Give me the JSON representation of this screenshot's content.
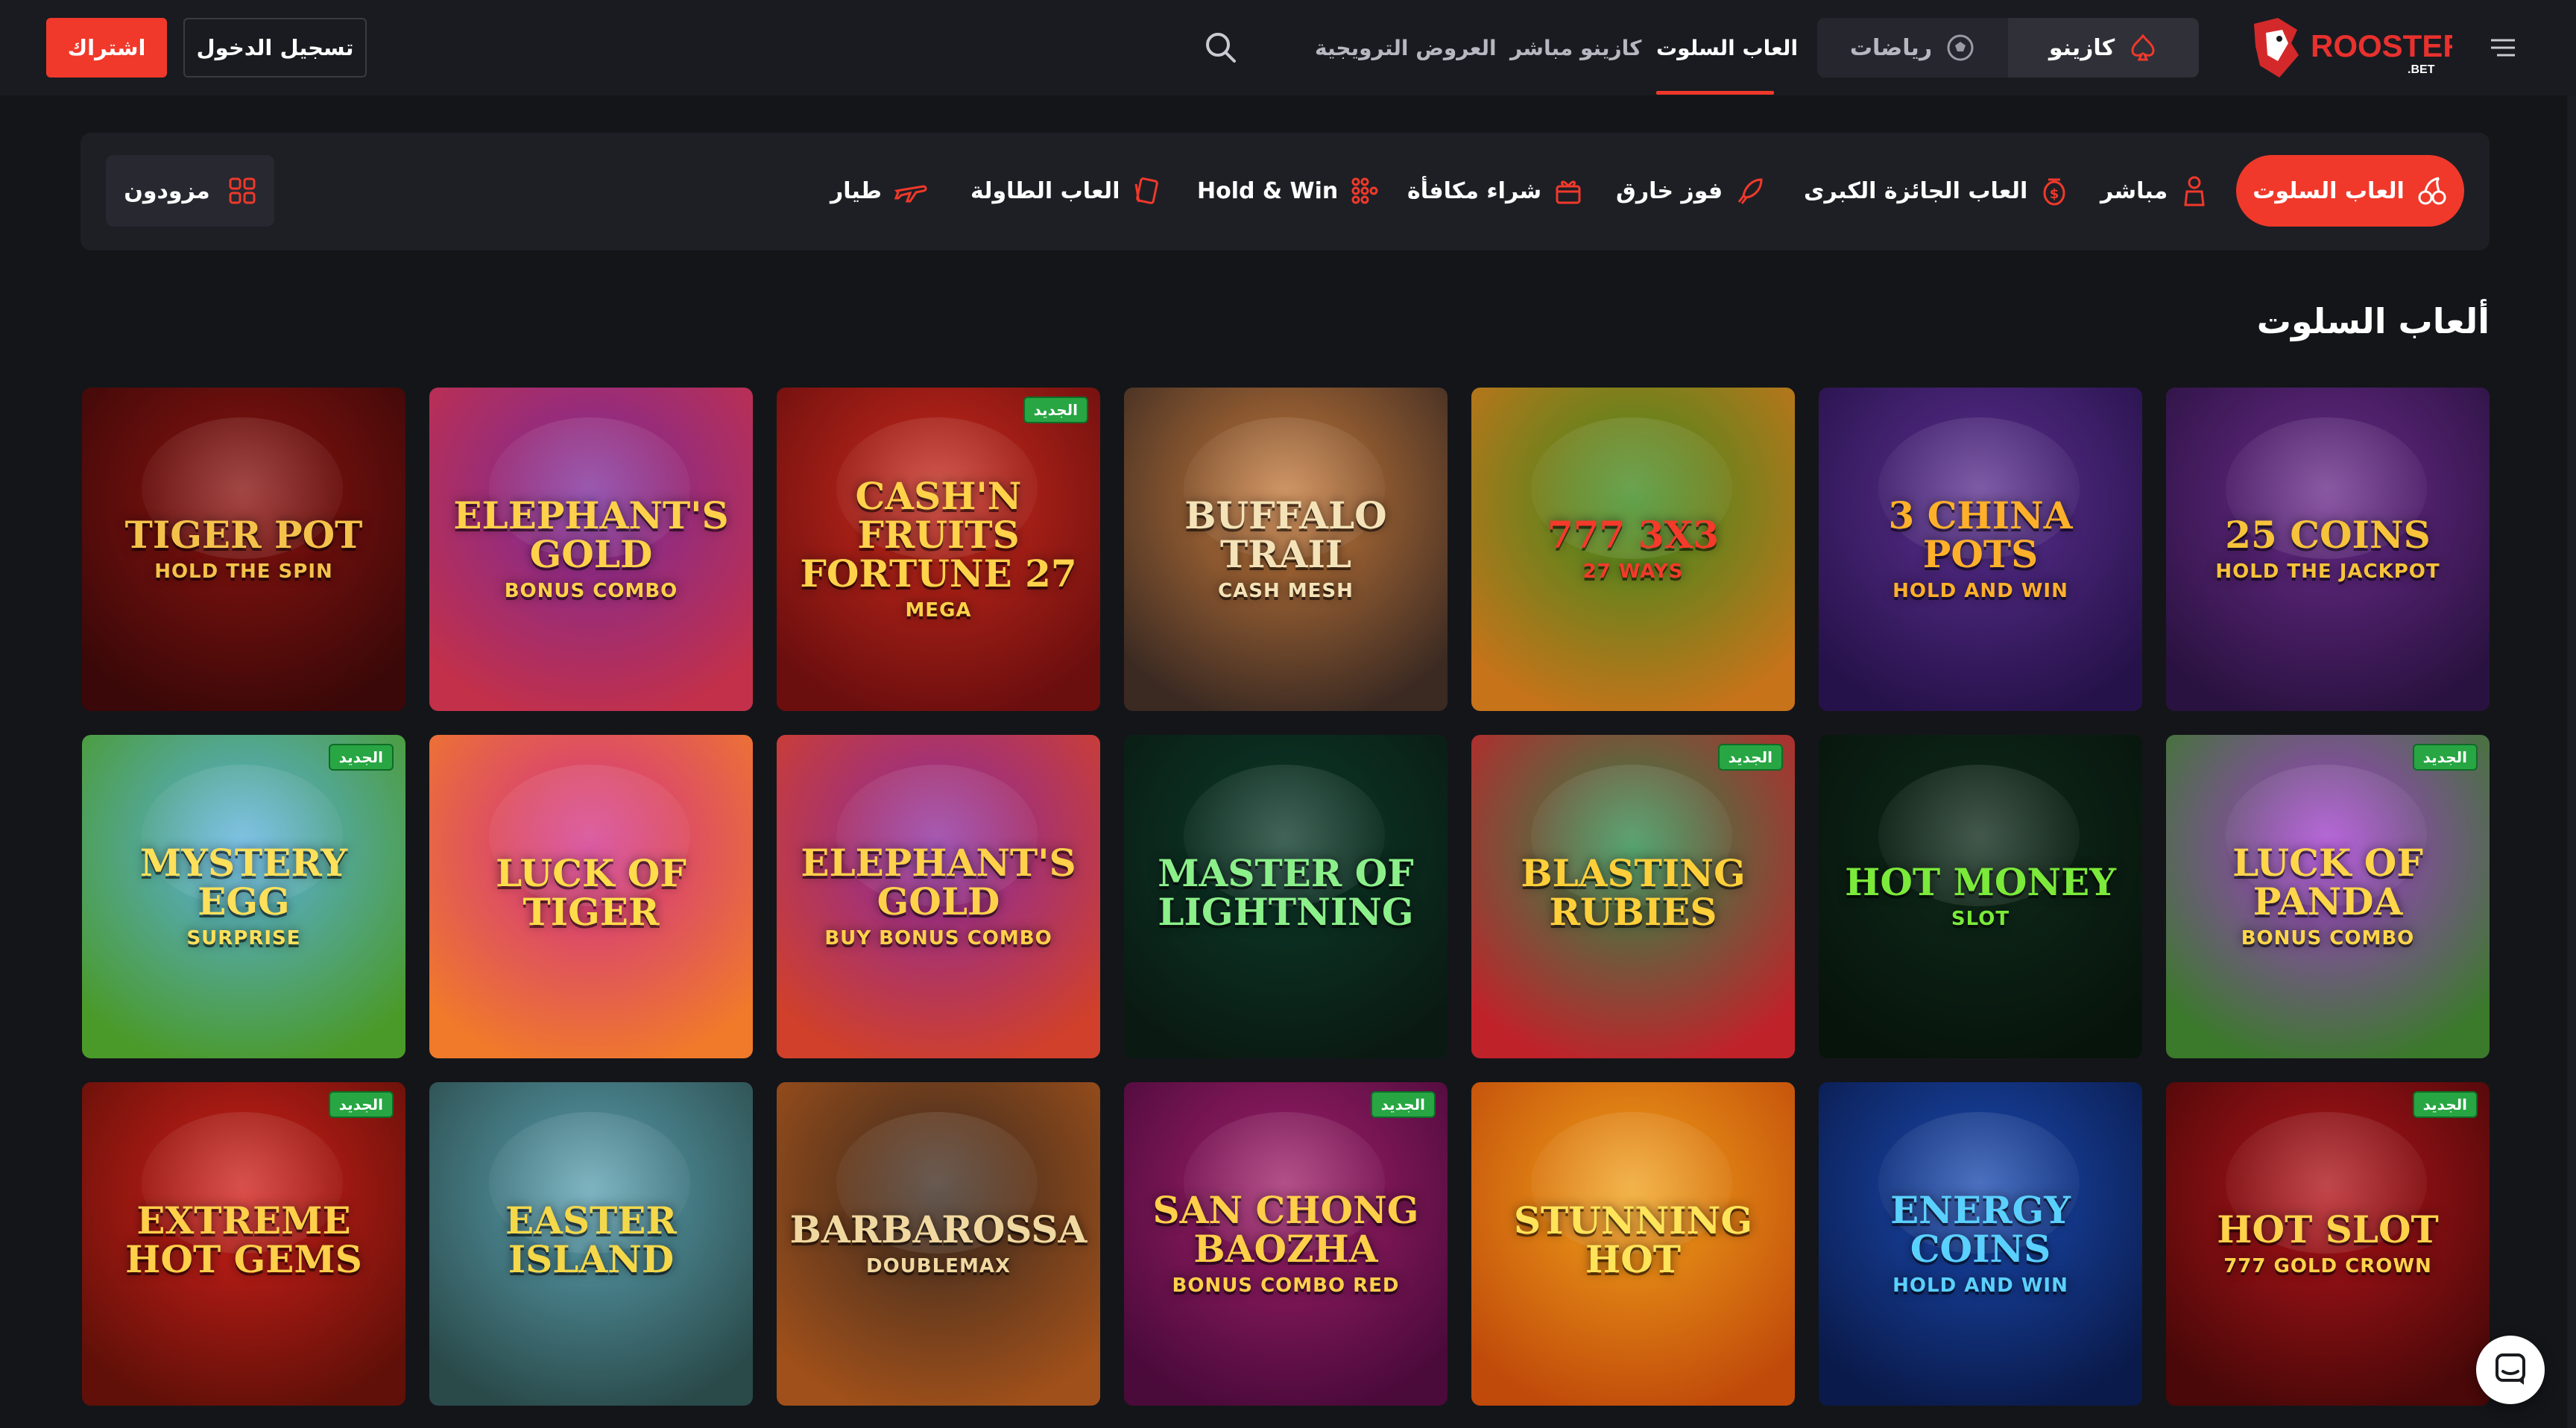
{
  "header": {
    "signup_label": "اشتراك",
    "login_label": "تسجيل الدخول",
    "nav": [
      {
        "label": "العروض الترويجية"
      },
      {
        "label": "كازينو مباشر"
      },
      {
        "label": "العاب السلوت"
      }
    ],
    "segments": [
      {
        "label": "رياضات",
        "icon": "soccer-ball-icon"
      },
      {
        "label": "كازينو",
        "icon": "spade-icon"
      }
    ],
    "logo_text": "ROOSTER",
    "logo_sub": ".BET"
  },
  "categories": {
    "providers_label": "مزودون",
    "items": [
      {
        "label": "العاب السلوت",
        "icon": "cherries-icon",
        "active": true
      },
      {
        "label": "مباشر",
        "icon": "dealer-icon"
      },
      {
        "label": "العاب الجائزة الكبرى",
        "icon": "coin-icon"
      },
      {
        "label": "فوز خارق",
        "icon": "rocket-icon"
      },
      {
        "label": "شراء مكافأة",
        "icon": "gift-icon"
      },
      {
        "label": "Hold & Win",
        "icon": "grid-dots-icon"
      },
      {
        "label": "العاب الطاولة",
        "icon": "cards-icon"
      },
      {
        "label": "طيار",
        "icon": "plane-icon"
      }
    ]
  },
  "section": {
    "title": "ألعاب السلوت"
  },
  "badge_label": "الجديد",
  "games": [
    {
      "title": "25 COINS",
      "sub": "HOLD THE JACKPOT",
      "new": false,
      "bg": "#6a2b8a",
      "bg2": "#2a1240",
      "fg": "#f6c33a"
    },
    {
      "title": "3 CHINA POTS",
      "sub": "HOLD AND WIN",
      "new": false,
      "bg": "#5b2f8f",
      "bg2": "#26124a",
      "fg": "#ffb02a"
    },
    {
      "title": "777 3X3",
      "sub": "27 WAYS",
      "new": false,
      "bg": "#3a8a1e",
      "bg2": "#c7731a",
      "fg": "#f43a2a"
    },
    {
      "title": "BUFFALO TRAIL",
      "sub": "CASH MESH",
      "new": false,
      "bg": "#c5793a",
      "bg2": "#3b2a22",
      "fg": "#f4e3b8"
    },
    {
      "title": "Cash'n Fruits Fortune 27",
      "sub": "MEGA",
      "new": true,
      "bg": "#c92a1c",
      "bg2": "#6a0e0e",
      "fg": "#ffd24a"
    },
    {
      "title": "ELEPHANT'S GOLD",
      "sub": "BONUS COMBO",
      "new": false,
      "bg": "#7a2a9b",
      "bg2": "#c2304a",
      "fg": "#ffd14a"
    },
    {
      "title": "TIGER POT",
      "sub": "HOLD THE SPIN",
      "new": false,
      "bg": "#8a1410",
      "bg2": "#3a0808",
      "fg": "#f4c24a"
    },
    {
      "title": "LUCK OF PANDA",
      "sub": "BONUS COMBO",
      "new": true,
      "bg": "#a33ad0",
      "bg2": "#3a7a2a",
      "fg": "#ffd64a"
    },
    {
      "title": "HOT MONEY",
      "sub": "Slot",
      "new": false,
      "bg": "#0f2a1a",
      "bg2": "#07140c",
      "fg": "#7bea3a"
    },
    {
      "title": "BLASTING RUBIES",
      "sub": "",
      "new": true,
      "bg": "#2a8a4a",
      "bg2": "#c0222a",
      "fg": "#ffcf3a"
    },
    {
      "title": "MASTER OF LIGHTNING",
      "sub": "",
      "new": false,
      "bg": "#0c3a2a",
      "bg2": "#0a1a12",
      "fg": "#8cf08a"
    },
    {
      "title": "ELEPHANT'S GOLD",
      "sub": "BUY BONUS COMBO",
      "new": false,
      "bg": "#8a2aa0",
      "bg2": "#d0402a",
      "fg": "#ffd14a"
    },
    {
      "title": "LUCK OF TIGER",
      "sub": "",
      "new": false,
      "bg": "#d0308a",
      "bg2": "#f07a2a",
      "fg": "#ffdc4a"
    },
    {
      "title": "MYSTERY EGG",
      "sub": "SURPRISE",
      "new": true,
      "bg": "#5ab0e0",
      "bg2": "#4a9a2a",
      "fg": "#ffe05a"
    },
    {
      "title": "HOT SLOT",
      "sub": "777 GOLD CROWN",
      "new": true,
      "bg": "#b0141a",
      "bg2": "#4a0808",
      "fg": "#ffd24a"
    },
    {
      "title": "ENERGY COINS",
      "sub": "HOLD AND WIN",
      "new": false,
      "bg": "#1a4ab0",
      "bg2": "#0a1a4a",
      "fg": "#5ad0ff"
    },
    {
      "title": "STUNNING HOT",
      "sub": "",
      "new": false,
      "bg": "#f0a01a",
      "bg2": "#c04a0a",
      "fg": "#ffe45a"
    },
    {
      "title": "SAN CHONG BAOZHA",
      "sub": "BONUS COMBO RED",
      "new": true,
      "bg": "#a0206a",
      "bg2": "#4a0a3a",
      "fg": "#ffcf4a"
    },
    {
      "title": "BARBAROSSA",
      "sub": "DOUBLEMAX",
      "new": false,
      "bg": "#3a2a20",
      "bg2": "#a0501a",
      "fg": "#f0d8a0"
    },
    {
      "title": "EASTER ISLAND",
      "sub": "",
      "new": false,
      "bg": "#5aa0b0",
      "bg2": "#2a4a4a",
      "fg": "#f4d84a"
    },
    {
      "title": "EXTREME HOT GEMS",
      "sub": "",
      "new": true,
      "bg": "#d0201a",
      "bg2": "#601008",
      "fg": "#ffcf4a"
    }
  ]
}
